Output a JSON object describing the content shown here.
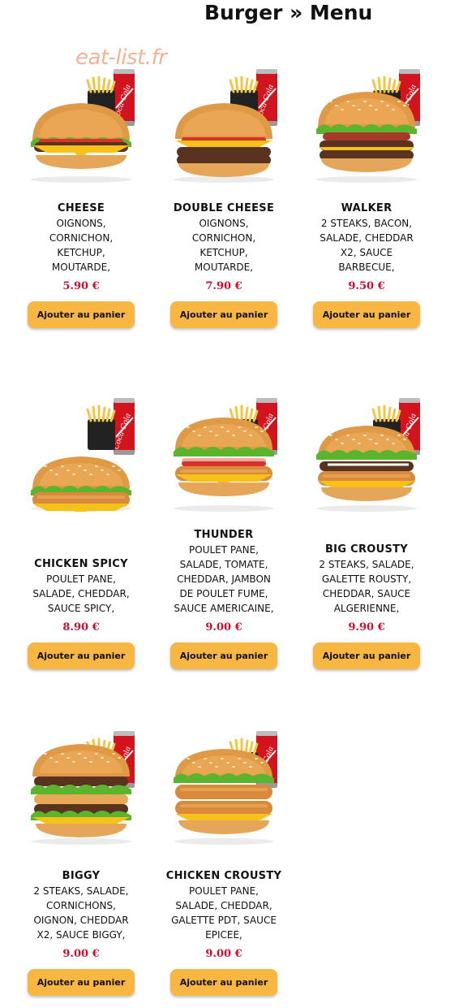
{
  "page": {
    "title": "Burger » Menu",
    "watermark": "eat-list.fr"
  },
  "add_to_cart_label": "Ajouter au panier",
  "products": [
    {
      "name": "CHEESE",
      "desc": [
        "OIGNONS,",
        "CORNICHON,",
        "KETCHUP,",
        "MOUTARDE,"
      ],
      "price": "5.90 €",
      "variant": "cheese",
      "drink": true
    },
    {
      "name": "DOUBLE CHEESE",
      "desc": [
        "OIGNONS,",
        "CORNICHON,",
        "KETCHUP,",
        "MOUTARDE,"
      ],
      "price": "7.90 €",
      "variant": "double",
      "drink": true
    },
    {
      "name": "WALKER",
      "desc": [
        "2 STEAKS, BACON,",
        "SALADE, CHEDDAR",
        "X2, SAUCE",
        "BARBECUE,"
      ],
      "price": "9.50 €",
      "variant": "walker",
      "drink": true
    },
    {
      "name": "CHICKEN SPICY",
      "desc": [
        "POULET PANE,",
        "SALADE, CHEDDAR,",
        "SAUCE SPICY,"
      ],
      "price": "8.90 €",
      "variant": "chicken",
      "drink": true
    },
    {
      "name": "THUNDER",
      "desc": [
        "POULET PANE,",
        "SALADE, TOMATE,",
        "CHEDDAR, JAMBON",
        "DE POULET FUME,",
        "SAUCE AMERICAINE,"
      ],
      "price": "9.00 €",
      "variant": "thunder",
      "drink": true
    },
    {
      "name": "BIG CROUSTY",
      "desc": [
        "2 STEAKS, SALADE,",
        "GALETTE ROUSTY,",
        "CHEDDAR, SAUCE",
        "ALGERIENNE,"
      ],
      "price": "9.90 €",
      "variant": "crousty",
      "drink": true
    },
    {
      "name": "BIGGY",
      "desc": [
        "2 STEAKS, SALADE,",
        "CORNICHONS,",
        "OIGNON, CHEDDAR",
        "X2, SAUCE BIGGY,"
      ],
      "price": "9.00 €",
      "variant": "biggy",
      "drink": true
    },
    {
      "name": "CHICKEN CROUSTY",
      "desc": [
        "POULET PANE,",
        "SALADE, CHEDDAR,",
        "GALETTE PDT, SAUCE",
        "EPICEE,"
      ],
      "price": "9.00 €",
      "variant": "chickcrousty",
      "drink": true
    }
  ]
}
